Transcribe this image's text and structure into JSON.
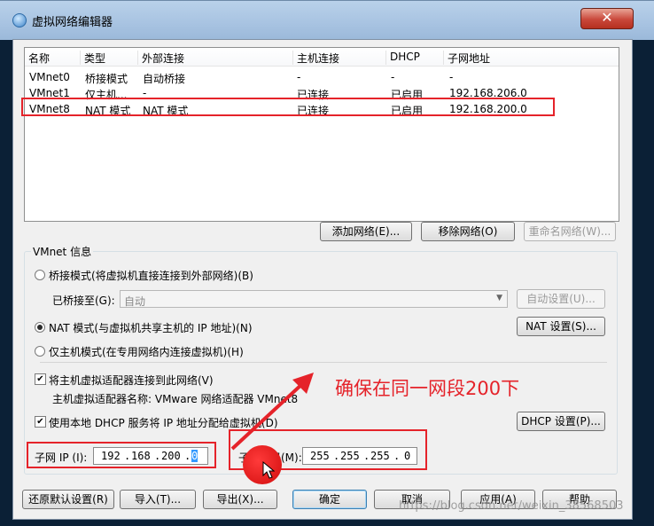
{
  "window": {
    "title": "虚拟网络编辑器",
    "close_glyph": "✕"
  },
  "table": {
    "headers": [
      "名称",
      "类型",
      "外部连接",
      "主机连接",
      "DHCP",
      "子网地址"
    ],
    "rows": [
      [
        "VMnet0",
        "桥接模式",
        "自动桥接",
        "-",
        "-",
        "-"
      ],
      [
        "VMnet1",
        "仅主机...",
        "-",
        "已连接",
        "已启用",
        "192.168.206.0"
      ],
      [
        "VMnet8",
        "NAT 模式",
        "NAT 模式",
        "已连接",
        "已启用",
        "192.168.200.0"
      ]
    ],
    "selected_row": 2
  },
  "table_buttons": {
    "add": "添加网络(E)...",
    "remove": "移除网络(O)",
    "rename": "重命名网络(W)..."
  },
  "info": {
    "group_title": "VMnet 信息",
    "bridged_radio": "桥接模式(将虚拟机直接连接到外部网络)(B)",
    "bridged_to_label": "已桥接至(G):",
    "bridged_to_value": "自动",
    "auto_settings": "自动设置(U)...",
    "nat_radio": "NAT 模式(与虚拟机共享主机的 IP 地址)(N)",
    "nat_settings": "NAT 设置(S)...",
    "hostonly_radio": "仅主机模式(在专用网络内连接虚拟机)(H)",
    "connect_adapter": "将主机虚拟适配器连接到此网络(V)",
    "adapter_name": "主机虚拟适配器名称: VMware 网络适配器 VMnet8",
    "use_dhcp": "使用本地 DHCP 服务将 IP 地址分配给虚拟机(D)",
    "dhcp_settings": "DHCP 设置(P)...",
    "subnet_ip_label": "子网 IP (I):",
    "subnet_ip": [
      "192",
      "168",
      "200",
      "0"
    ],
    "subnet_mask_label": "子网掩码(M):",
    "subnet_mask": [
      "255",
      "255",
      "255",
      "0"
    ],
    "selected_mode": "nat",
    "connect_adapter_checked": true,
    "use_dhcp_checked": true
  },
  "bottom_buttons": {
    "restore": "还原默认设置(R)",
    "import": "导入(T)...",
    "export": "导出(X)...",
    "ok": "确定",
    "cancel": "取消",
    "apply": "应用(A)",
    "help": "帮助"
  },
  "annotation": {
    "text": "确保在同一网段200下",
    "color": "#e5232a"
  },
  "watermark": "https://blog.csdn.net/weixin_38568503"
}
